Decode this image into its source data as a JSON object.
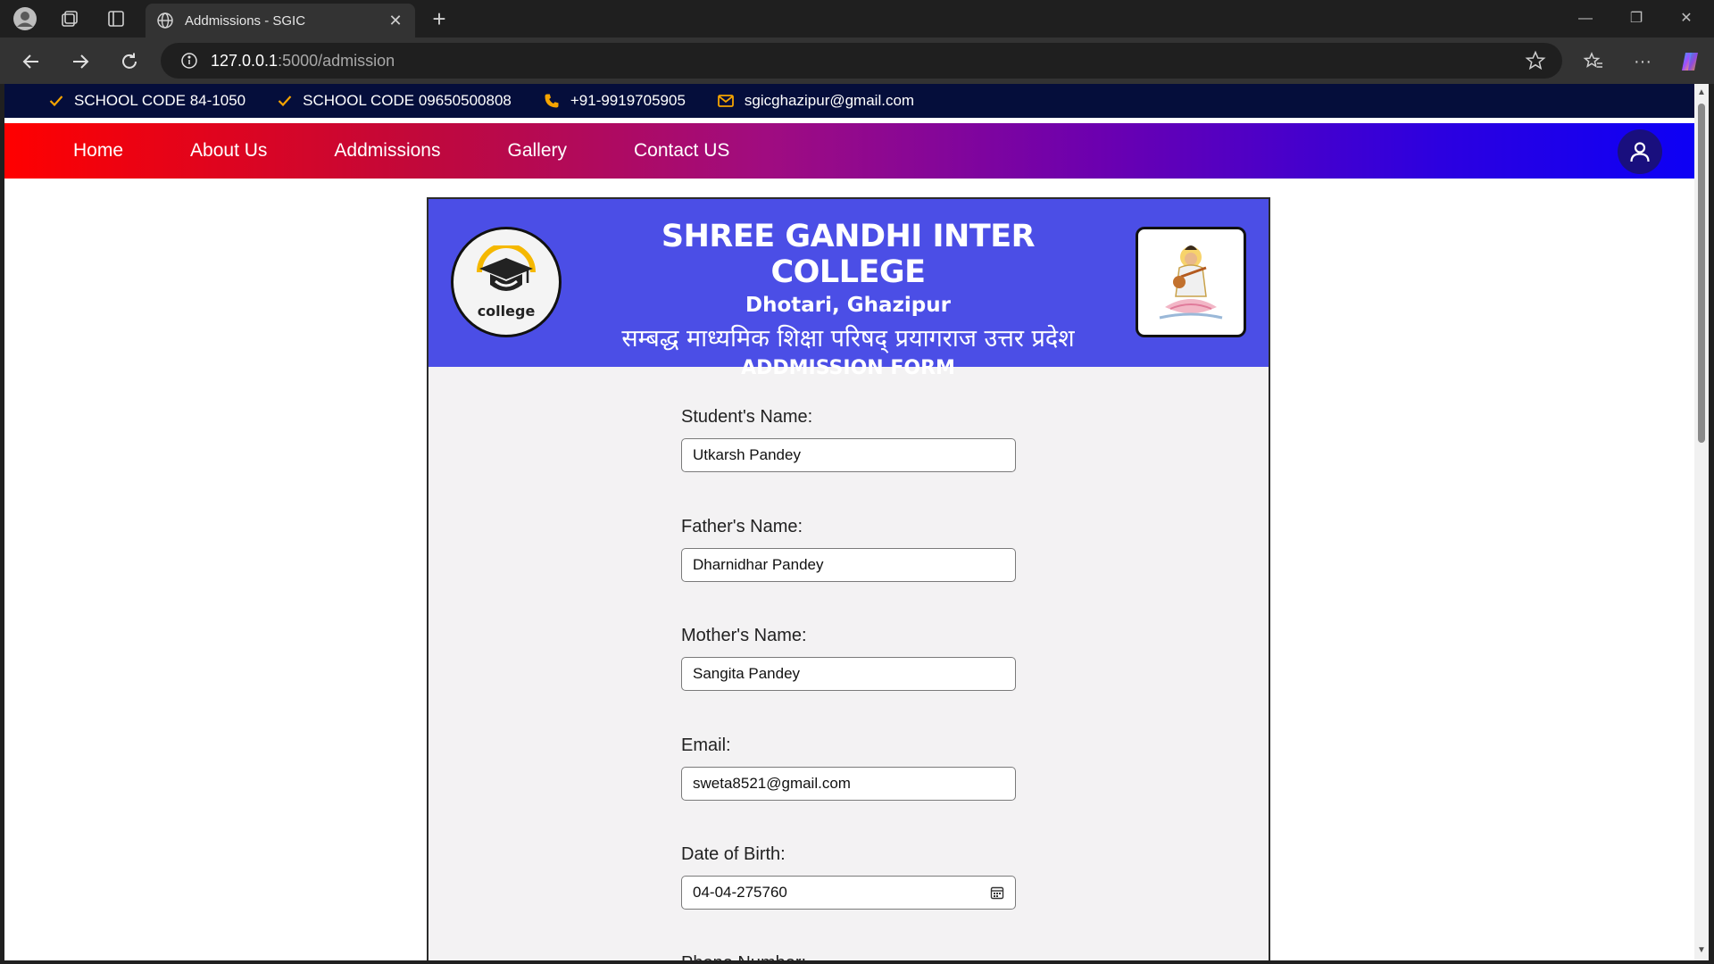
{
  "browser": {
    "tab_title": "Addmissions - SGIC",
    "url_host": "127.0.0.1",
    "url_path": ":5000/admission"
  },
  "topbar": {
    "items": [
      {
        "icon": "check-icon",
        "text": "SCHOOL CODE 84-1050"
      },
      {
        "icon": "check-icon",
        "text": "SCHOOL CODE 09650500808"
      },
      {
        "icon": "phone-icon",
        "text": "+91-9919705905"
      },
      {
        "icon": "mail-icon",
        "text": "sgicghazipur@gmail.com"
      }
    ],
    "icon_color": "#f5a400",
    "background": "#050e3b"
  },
  "nav": {
    "links": [
      "Home",
      "About Us",
      "Addmissions",
      "Gallery",
      "Contact US"
    ]
  },
  "form_header": {
    "title": "SHREE GANDHI INTER COLLEGE",
    "subtitle": "Dhotari, Ghazipur",
    "affiliation": "सम्बद्ध माध्यमिक शिक्षा परिषद् प्रयागराज उत्तर प्रदेश",
    "form_title": "ADDMISSION FORM",
    "logo_text": "college",
    "background": "#4b4ee6"
  },
  "form": {
    "fields": [
      {
        "label": "Student's Name:",
        "value": "Utkarsh Pandey"
      },
      {
        "label": "Father's Name:",
        "value": "Dharnidhar Pandey"
      },
      {
        "label": "Mother's Name:",
        "value": "Sangita Pandey"
      },
      {
        "label": "Email:",
        "value": "sweta8521@gmail.com"
      },
      {
        "label": "Date of Birth:",
        "value": "04-04-275760"
      }
    ],
    "next_label": "Phone Number:"
  }
}
